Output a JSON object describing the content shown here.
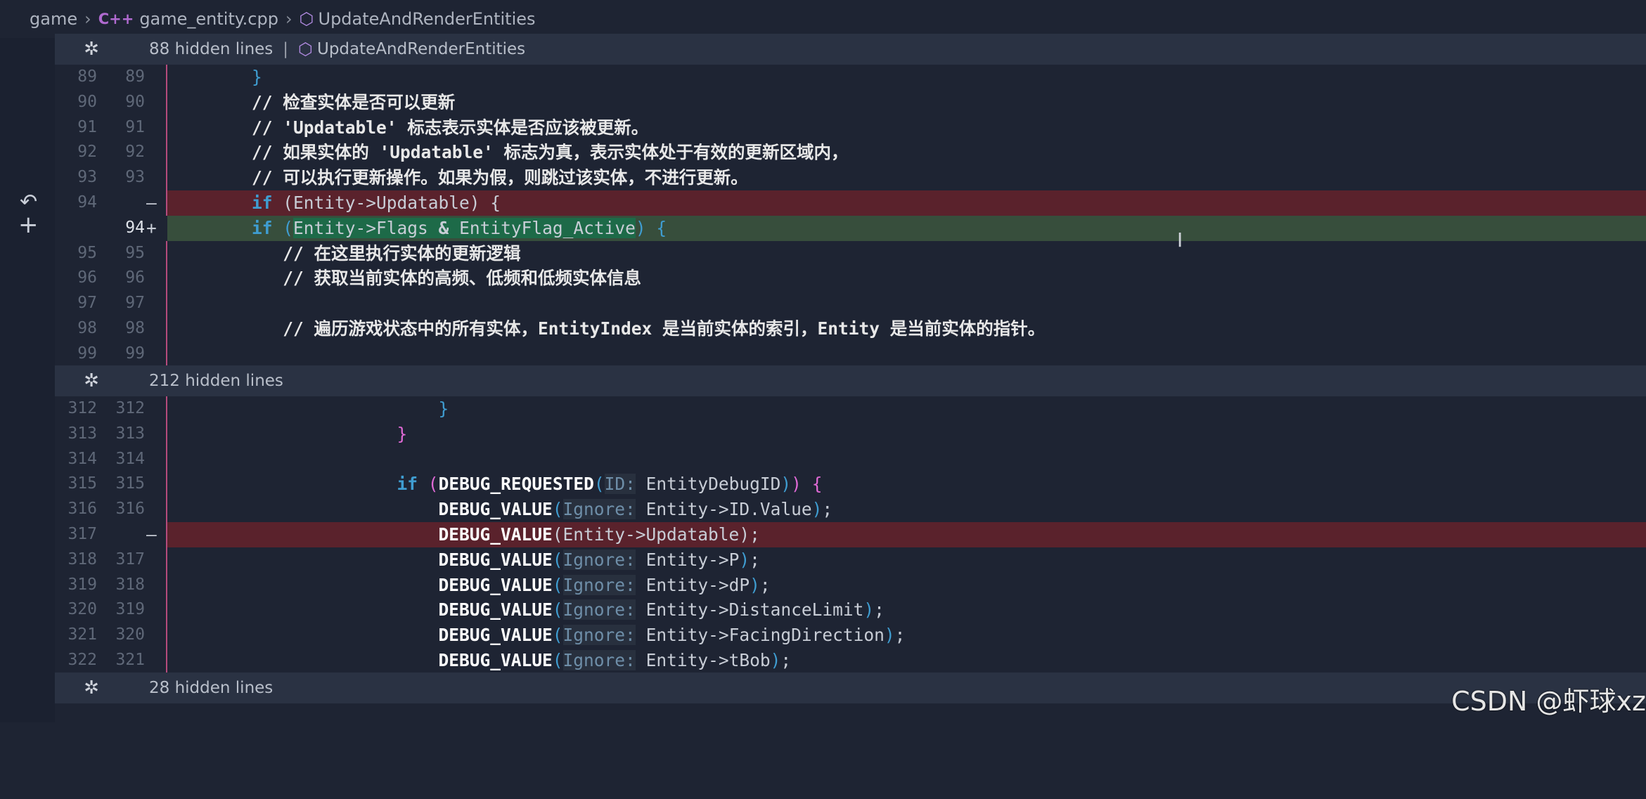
{
  "breadcrumb": {
    "folder": "game",
    "file": "game_entity.cpp",
    "file_icon": "C++",
    "symbol": "UpdateAndRenderEntities"
  },
  "hidden_bars": [
    {
      "count_label": "88 hidden lines",
      "symbol": "UpdateAndRenderEntities"
    },
    {
      "count_label": "212 hidden lines"
    },
    {
      "count_label": "28 hidden lines"
    }
  ],
  "block1": {
    "lines": [
      {
        "old": "89",
        "new": "89"
      },
      {
        "old": "90",
        "new": "90",
        "text": "// 检查实体是否可以更新"
      },
      {
        "old": "91",
        "new": "91",
        "text": "// 'Updatable' 标志表示实体是否应该被更新。"
      },
      {
        "old": "92",
        "new": "92",
        "text": "// 如果实体的 'Updatable' 标志为真，表示实体处于有效的更新区域内，"
      },
      {
        "old": "93",
        "new": "93",
        "text": "// 可以执行更新操作。如果为假，则跳过该实体，不进行更新。"
      },
      {
        "old": "94",
        "new": "",
        "marker": "—"
      },
      {
        "old": "",
        "new": "94",
        "marker": "+"
      },
      {
        "old": "95",
        "new": "95",
        "text": "// 在这里执行实体的更新逻辑"
      },
      {
        "old": "96",
        "new": "96",
        "text": "// 获取当前实体的高频、低频和低频实体信息"
      },
      {
        "old": "97",
        "new": "97"
      },
      {
        "old": "98",
        "new": "98",
        "text": "// 遍历游戏状态中的所有实体，EntityIndex 是当前实体的索引，Entity 是当前实体的指针。"
      },
      {
        "old": "99",
        "new": "99"
      }
    ],
    "code_removed": {
      "kw": "if",
      "rest": " (Entity->Updatable) {"
    },
    "code_added": {
      "kw": "if",
      "open": " (",
      "pre": "Entity->Flags ",
      "amp": "&",
      "post": " EntityFlag_Active",
      "close": ") {"
    }
  },
  "block2": {
    "lines": [
      {
        "old": "312",
        "new": "312"
      },
      {
        "old": "313",
        "new": "313"
      },
      {
        "old": "314",
        "new": "314"
      },
      {
        "old": "315",
        "new": "315"
      },
      {
        "old": "316",
        "new": "316"
      },
      {
        "old": "317",
        "new": "",
        "marker": "—"
      },
      {
        "old": "318",
        "new": "317"
      },
      {
        "old": "319",
        "new": "318"
      },
      {
        "old": "320",
        "new": "319"
      },
      {
        "old": "321",
        "new": "320"
      },
      {
        "old": "322",
        "new": "321"
      }
    ],
    "code": {
      "if_kw": "if",
      "debug_requested": "DEBUG_REQUESTED",
      "id_hint": "ID:",
      "entity_debug_id": "EntityDebugID",
      "debug_value": "DEBUG_VALUE",
      "ignore_hint": "Ignore:",
      "arg_id": "Entity->ID.Value",
      "arg_updatable": "Entity->Updatable",
      "arg_p": "Entity->P",
      "arg_dp": "Entity->dP",
      "arg_distance": "Entity->DistanceLimit",
      "arg_facing": "Entity->FacingDirection",
      "arg_tbob": "Entity->tBob"
    }
  },
  "watermark": "CSDN @虾球xz"
}
